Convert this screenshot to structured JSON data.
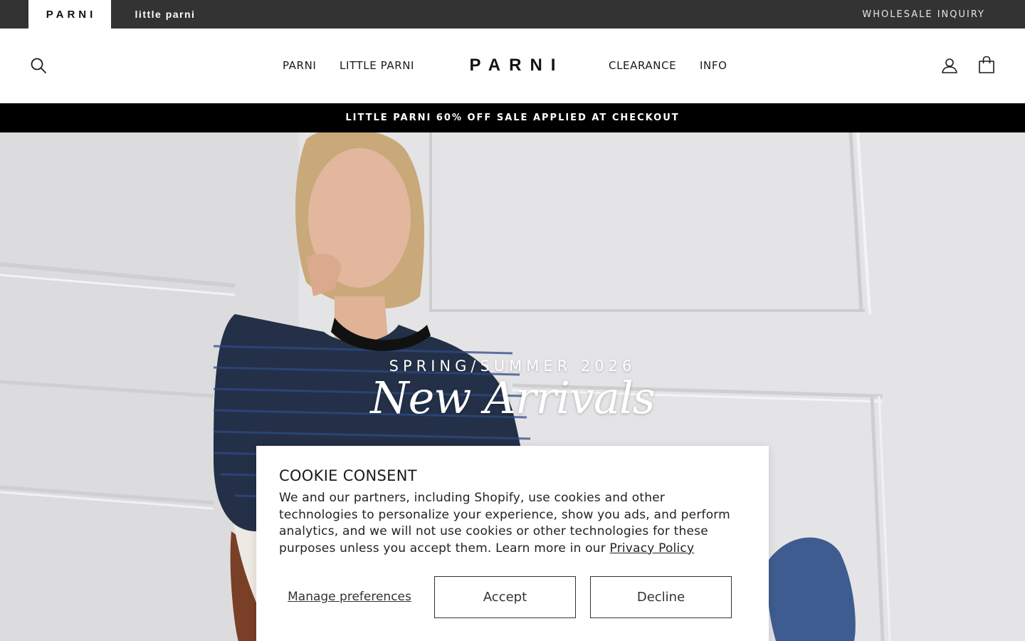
{
  "topbar": {
    "brand_parni": "PARNI",
    "brand_little": "little parni",
    "wholesale_link": "WHOLESALE INQUIRY"
  },
  "header": {
    "logo": "PARNI",
    "nav": {
      "parni": "PARNI",
      "little_parni": "LITTLE PARNI",
      "clearance": "CLEARANCE",
      "info": "INFO"
    },
    "icons": {
      "search": "search-icon",
      "account": "account-icon",
      "cart": "cart-icon"
    }
  },
  "announcement": "LITTLE PARNI 60% OFF SALE APPLIED AT CHECKOUT",
  "hero": {
    "eyebrow": "SPRING/SUMMER 2026",
    "title": "New Arrivals"
  },
  "cookie": {
    "title": "COOKIE CONSENT",
    "body": "We and our partners, including Shopify, use cookies and other technologies to personalize your experience, show you ads, and perform analytics, and we will not use cookies or other technologies for these purposes unless you accept them. Learn more in our ",
    "privacy_link": "Privacy Policy",
    "manage_label": "Manage preferences",
    "accept_label": "Accept",
    "decline_label": "Decline"
  },
  "colors": {
    "topbar_bg": "#333333",
    "announcement_bg": "#000000",
    "text": "#1a1a1a"
  }
}
